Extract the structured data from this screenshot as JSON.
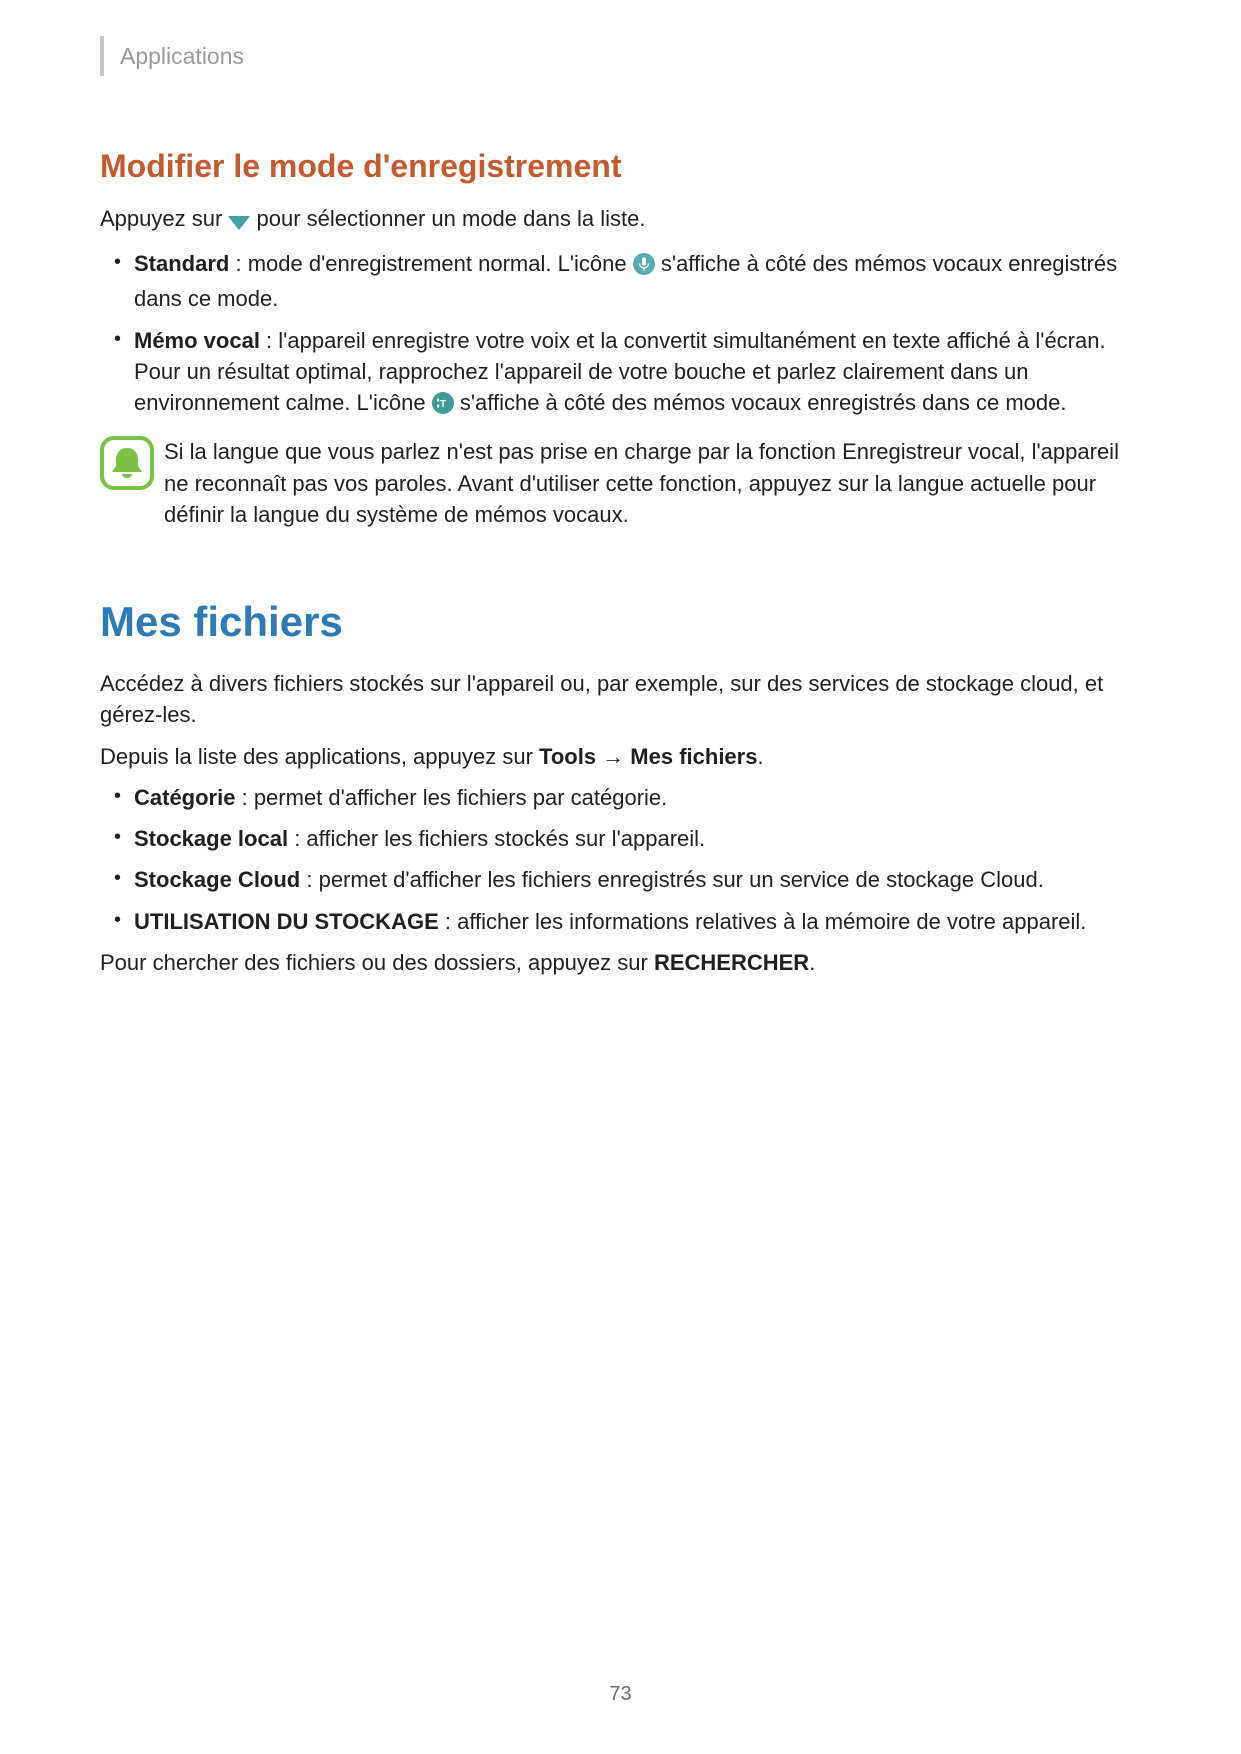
{
  "colors": {
    "section_heading": "#c45a30",
    "page_heading": "#2d7bb6",
    "note_green": "#7bc143",
    "icon_blue_green": "#5aaab0",
    "icon_teal": "#3f9b94",
    "dropdown_teal": "#3fa0a8"
  },
  "header": {
    "breadcrumb": "Applications"
  },
  "section1": {
    "heading": "Modifier le mode d'enregistrement",
    "intro_before": "Appuyez sur ",
    "intro_after": " pour sélectionner un mode dans la liste.",
    "items": [
      {
        "label": "Standard",
        "text_before_icon": " : mode d'enregistrement normal. L'icône ",
        "text_after_icon": " s'affiche à côté des mémos vocaux enregistrés dans ce mode."
      },
      {
        "label": "Mémo vocal",
        "text_before_icon": " : l'appareil enregistre votre voix et la convertit simultanément en texte affiché à l'écran. Pour un résultat optimal, rapprochez l'appareil de votre bouche et parlez clairement dans un environnement calme. L'icône ",
        "text_after_icon": " s'affiche à côté des mémos vocaux enregistrés dans ce mode."
      }
    ],
    "note": "Si la langue que vous parlez n'est pas prise en charge par la fonction Enregistreur vocal, l'appareil ne reconnaît pas vos paroles. Avant d'utiliser cette fonction, appuyez sur la langue actuelle pour définir la langue du système de mémos vocaux."
  },
  "section2": {
    "heading": "Mes fichiers",
    "intro": "Accédez à divers fichiers stockés sur l'appareil ou, par exemple, sur des services de stockage cloud, et gérez-les.",
    "instruction_before": "Depuis la liste des applications, appuyez sur ",
    "instruction_tools": "Tools",
    "instruction_arrow": " → ",
    "instruction_target": "Mes fichiers",
    "instruction_after": ".",
    "items": [
      {
        "label": "Catégorie",
        "text": " : permet d'afficher les fichiers par catégorie."
      },
      {
        "label": "Stockage local",
        "text": " : afficher les fichiers stockés sur l'appareil."
      },
      {
        "label": "Stockage Cloud",
        "text": " : permet d'afficher les fichiers enregistrés sur un service de stockage Cloud."
      },
      {
        "label": "UTILISATION DU STOCKAGE",
        "text": " : afficher les informations relatives à la mémoire de votre appareil."
      }
    ],
    "search_before": "Pour chercher des fichiers ou des dossiers, appuyez sur ",
    "search_label": "RECHERCHER",
    "search_after": "."
  },
  "page_number": "73"
}
